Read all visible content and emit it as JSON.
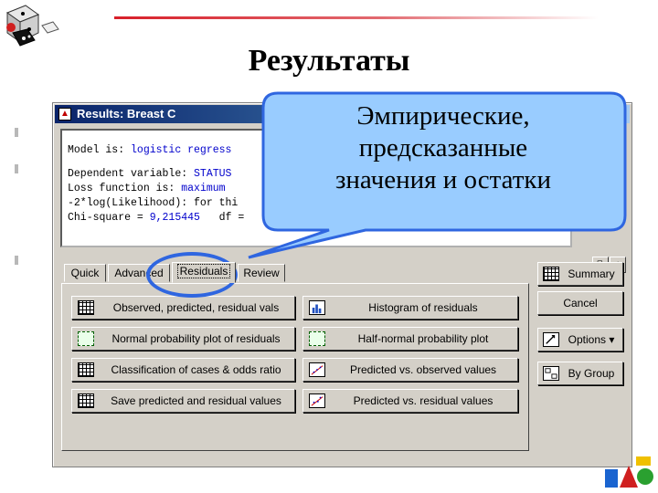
{
  "slide": {
    "title": "Результаты",
    "callout_text": [
      "Эмпирические,",
      "предсказанные",
      "значения и остатки"
    ]
  },
  "window": {
    "title": "Results: Breast C",
    "output_lines": [
      [
        {
          "t": "Model is: ",
          "c": "lbl"
        },
        {
          "t": "logistic regress",
          "c": "val"
        }
      ],
      [],
      [
        {
          "t": "Dependent variable: ",
          "c": "lbl"
        },
        {
          "t": "STATUS",
          "c": "val"
        }
      ],
      [
        {
          "t": "Loss function is: ",
          "c": "lbl"
        },
        {
          "t": "maximum",
          "c": "val"
        }
      ],
      [
        {
          "t": "-2*log(Likelihood): for thi",
          "c": "lbl"
        }
      ],
      [
        {
          "t": "Chi-square = ",
          "c": "lbl"
        },
        {
          "t": "9,215445",
          "c": "val"
        },
        {
          "t": "   df = ",
          "c": "lbl"
        }
      ]
    ],
    "mini_buttons": [
      "⧉",
      "↕"
    ]
  },
  "tabs": [
    {
      "label": "Quick",
      "active": false
    },
    {
      "label": "Advanced",
      "active": false
    },
    {
      "label": "Residuals",
      "active": true
    },
    {
      "label": "Review",
      "active": false
    }
  ],
  "actions": {
    "observed": "Observed, predicted, residual vals",
    "histogram": "Histogram of residuals",
    "normal_plot": "Normal probability plot of residuals",
    "half_normal": "Half-normal probability plot",
    "classification": "Classification of cases & odds ratio",
    "pred_vs_obs": "Predicted vs. observed values",
    "save": "Save predicted and residual values",
    "pred_vs_resid": "Predicted vs. residual values"
  },
  "right_buttons": {
    "summary": "Summary",
    "cancel": "Cancel",
    "options": "Options",
    "by_group": "By Group"
  },
  "colors": {
    "callout_fill": "#99ccff",
    "callout_border": "#2f66e0",
    "output_value": "#0000cc",
    "titlebar": "#0a246a"
  }
}
